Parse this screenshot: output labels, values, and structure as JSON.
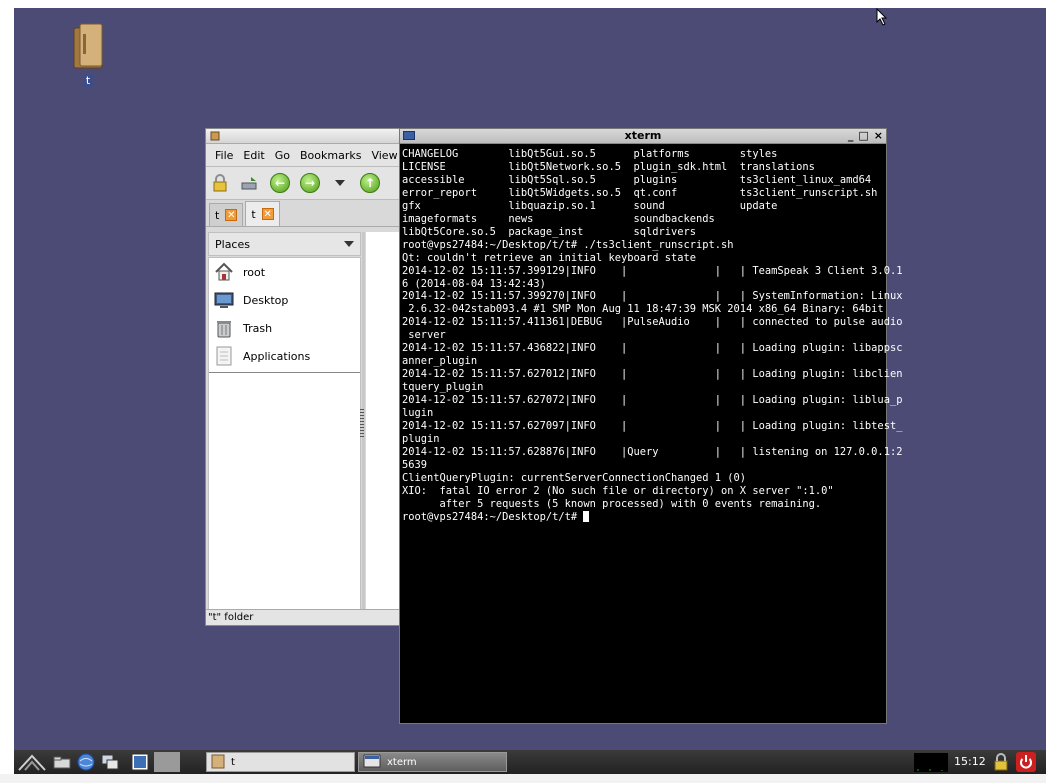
{
  "desktop": {
    "icons": [
      {
        "label": "t",
        "icon": "folder-icon"
      }
    ]
  },
  "file_manager": {
    "menu": [
      "File",
      "Edit",
      "Go",
      "Bookmarks",
      "View"
    ],
    "tabs": [
      {
        "label": "t",
        "active": false
      },
      {
        "label": "t",
        "active": true
      }
    ],
    "places_header": "Places",
    "places": [
      {
        "label": "root",
        "icon": "home-icon"
      },
      {
        "label": "Desktop",
        "icon": "desktop-icon"
      },
      {
        "label": "Trash",
        "icon": "trash-icon"
      },
      {
        "label": "Applications",
        "icon": "applications-icon"
      }
    ],
    "status": "\"t\" folder"
  },
  "xterm": {
    "title": "xterm",
    "buttons": [
      "_",
      "□",
      "×"
    ],
    "lines": [
      "CHANGELOG        libQt5Gui.so.5      platforms        styles",
      "LICENSE          libQt5Network.so.5  plugin_sdk.html  translations",
      "accessible       libQt5Sql.so.5      plugins          ts3client_linux_amd64",
      "error_report     libQt5Widgets.so.5  qt.conf          ts3client_runscript.sh",
      "gfx              libquazip.so.1      sound            update",
      "imageformats     news                soundbackends",
      "libQt5Core.so.5  package_inst        sqldrivers",
      "root@vps27484:~/Desktop/t/t# ./ts3client_runscript.sh",
      "Qt: couldn't retrieve an initial keyboard state",
      "2014-12-02 15:11:57.399129|INFO    |              |   | TeamSpeak 3 Client 3.0.1",
      "6 (2014-08-04 13:42:43)",
      "2014-12-02 15:11:57.399270|INFO    |              |   | SystemInformation: Linux",
      " 2.6.32-042stab093.4 #1 SMP Mon Aug 11 18:47:39 MSK 2014 x86_64 Binary: 64bit",
      "2014-12-02 15:11:57.411361|DEBUG   |PulseAudio    |   | connected to pulse audio",
      " server",
      "2014-12-02 15:11:57.436822|INFO    |              |   | Loading plugin: libappsc",
      "anner_plugin",
      "2014-12-02 15:11:57.627012|INFO    |              |   | Loading plugin: libclien",
      "tquery_plugin",
      "2014-12-02 15:11:57.627072|INFO    |              |   | Loading plugin: liblua_p",
      "lugin",
      "2014-12-02 15:11:57.627097|INFO    |              |   | Loading plugin: libtest_",
      "plugin",
      "2014-12-02 15:11:57.628876|INFO    |Query         |   | listening on 127.0.0.1:2",
      "5639",
      "ClientQueryPlugin: currentServerConnectionChanged 1 (0)",
      "XIO:  fatal IO error 2 (No such file or directory) on X server \":1.0\"",
      "      after 5 requests (5 known processed) with 0 events remaining."
    ],
    "prompt": "root@vps27484:~/Desktop/t/t# "
  },
  "taskbar": {
    "tasks": [
      {
        "label": "t",
        "icon": "folder-icon"
      },
      {
        "label": "xterm",
        "icon": "terminal-icon"
      }
    ],
    "clock": "15:12"
  },
  "colors": {
    "desktop": "#4c4b76",
    "taskbar": "#2b2b2b",
    "power": "#cc2020"
  }
}
